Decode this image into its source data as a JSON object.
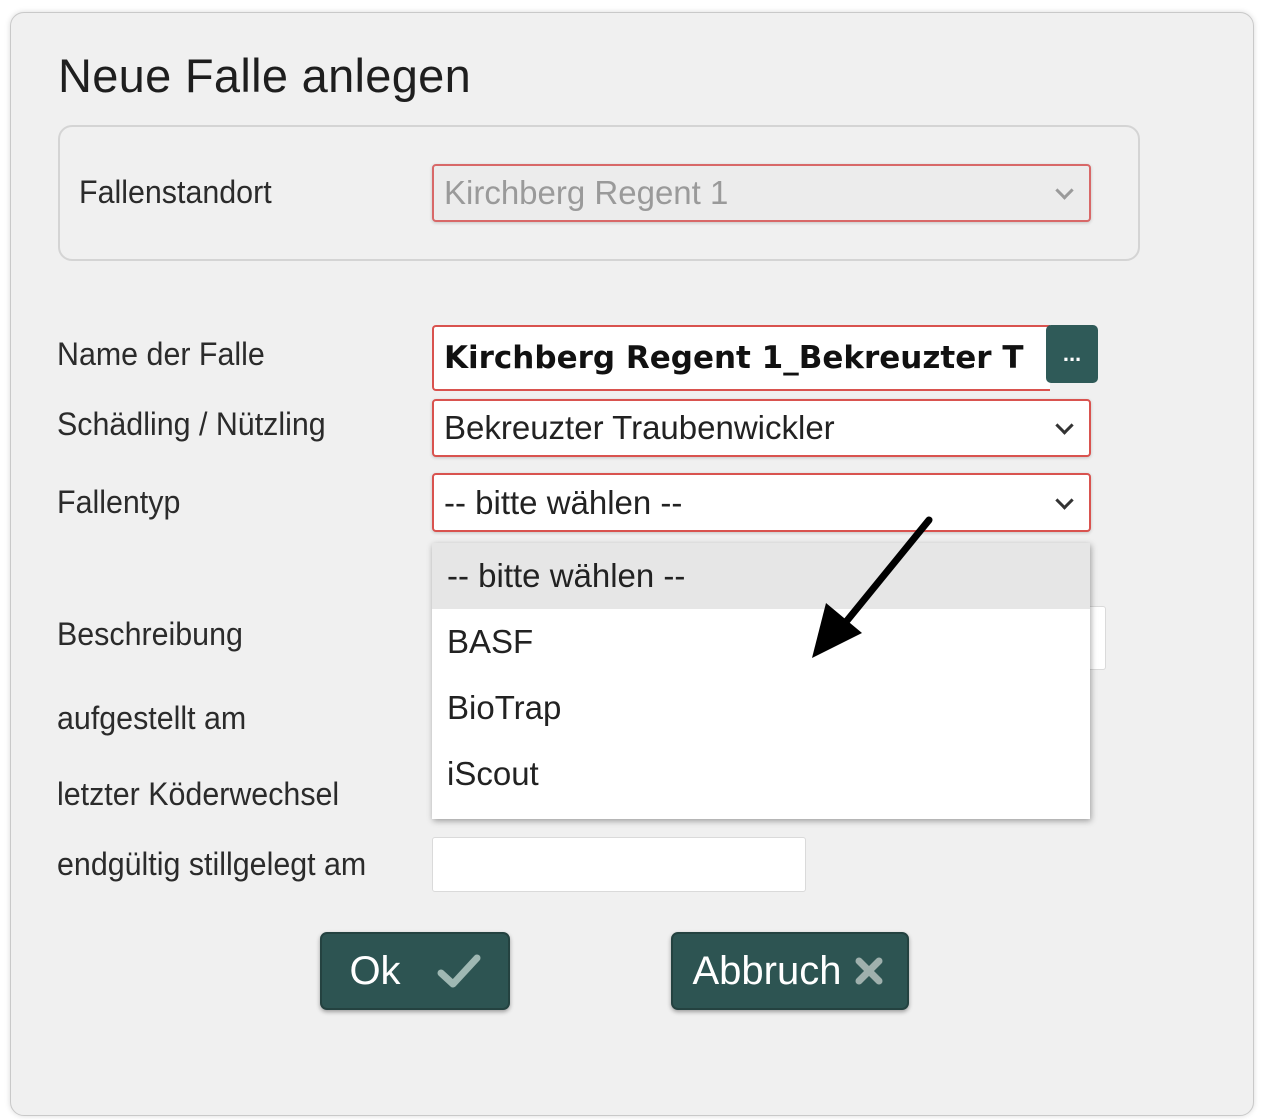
{
  "dialog": {
    "title": "Neue Falle anlegen"
  },
  "fallenstandort": {
    "label": "Fallenstandort",
    "value": "Kirchberg Regent 1"
  },
  "name": {
    "label": "Name der Falle",
    "value": "Kirchberg Regent 1_Bekreuzter T",
    "more_button": "..."
  },
  "schaedling": {
    "label": "Schädling / Nützling",
    "value": "Bekreuzter Traubenwickler"
  },
  "fallentyp": {
    "label": "Fallentyp",
    "value": "-- bitte wählen --",
    "options": [
      "-- bitte wählen --",
      "BASF",
      "BioTrap",
      "iScout"
    ]
  },
  "beschreibung": {
    "label": "Beschreibung"
  },
  "aufgestellt": {
    "label": "aufgestellt am"
  },
  "koederwechsel": {
    "label": "letzter Köderwechsel"
  },
  "stillgelegt": {
    "label": "endgültig stillgelegt am"
  },
  "buttons": {
    "ok": "Ok",
    "cancel": "Abbruch"
  },
  "colors": {
    "button_bg": "#2d5452",
    "invalid_border": "#d9534f",
    "dialog_bg": "#f0f0f0"
  }
}
